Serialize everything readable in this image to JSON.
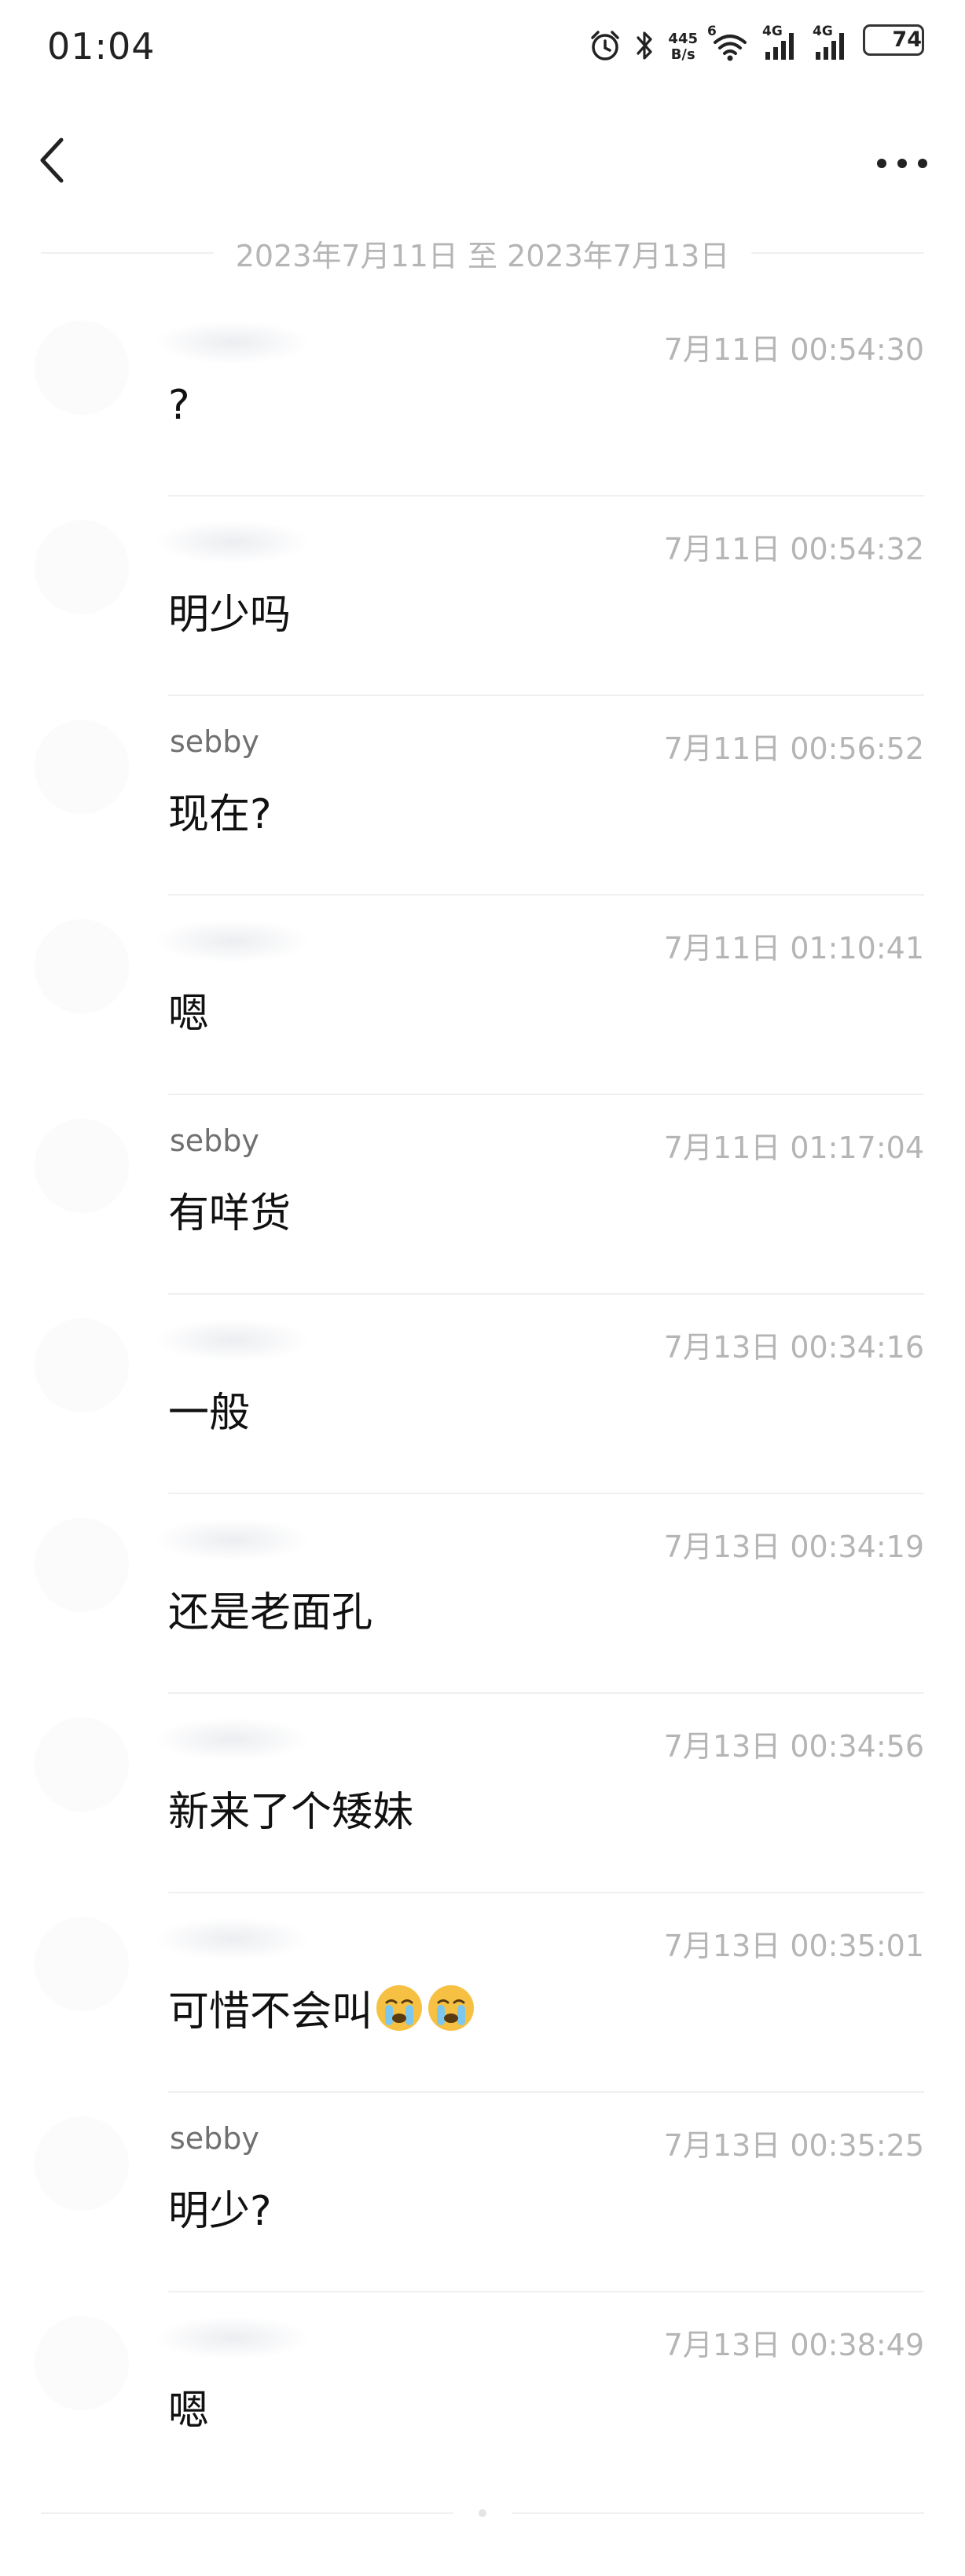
{
  "status_bar": {
    "time": "01:04",
    "net_speed_value": "445",
    "net_speed_unit": "B/s",
    "wifi_badge": "6",
    "signal1_label": "4G",
    "signal2_label": "4G",
    "battery": "74",
    "battery_level": 0.74,
    "icons": [
      "alarm-icon",
      "bluetooth-icon",
      "wifi-icon",
      "signal-icon",
      "signal-icon",
      "battery-icon"
    ]
  },
  "nav": {
    "back_icon": "chevron-left-icon",
    "more_icon": "more-horizontal-icon"
  },
  "date_range": "2023年7月11日 至 2023年7月13日",
  "messages": [
    {
      "sender": "",
      "time": "7月11日 00:54:30",
      "text": "?"
    },
    {
      "sender": "",
      "time": "7月11日 00:54:32",
      "text": "明少吗"
    },
    {
      "sender": "sebby",
      "time": "7月11日 00:56:52",
      "text": "现在?"
    },
    {
      "sender": "",
      "time": "7月11日 01:10:41",
      "text": "嗯"
    },
    {
      "sender": "sebby",
      "time": "7月11日 01:17:04",
      "text": "有咩货"
    },
    {
      "sender": "",
      "time": "7月13日 00:34:16",
      "text": "一般"
    },
    {
      "sender": "",
      "time": "7月13日 00:34:19",
      "text": "还是老面孔"
    },
    {
      "sender": "",
      "time": "7月13日 00:34:56",
      "text": "新来了个矮妹"
    },
    {
      "sender": "",
      "time": "7月13日 00:35:01",
      "text": "可惜不会叫",
      "emojis": [
        "crying-face-emoji",
        "crying-face-emoji"
      ]
    },
    {
      "sender": "sebby",
      "time": "7月13日 00:35:25",
      "text": "明少?"
    },
    {
      "sender": "",
      "time": "7月13日 00:38:49",
      "text": "嗯"
    }
  ],
  "colors": {
    "text_primary": "#111111",
    "text_secondary": "#707070",
    "text_muted": "#b5b5b5",
    "divider": "#f0f0f0",
    "emoji_yellow": "#f6c142"
  }
}
